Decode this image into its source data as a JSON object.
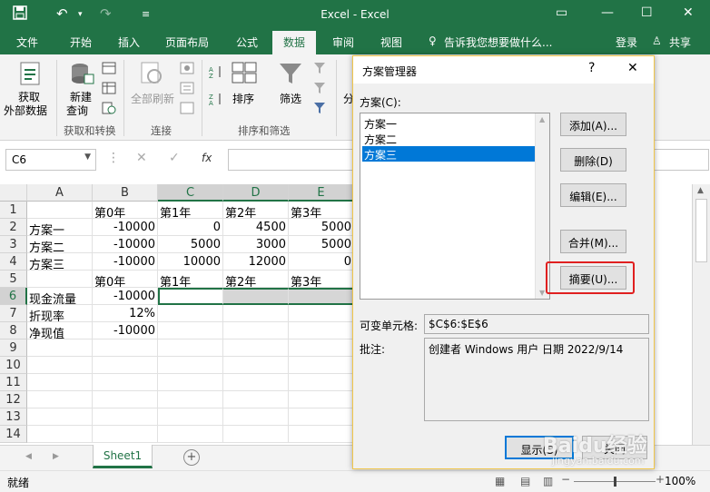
{
  "titlebar": {
    "title": "Excel - Excel",
    "save_icon": "save-icon",
    "undo_icon": "undo-icon",
    "redo_icon": "redo-icon",
    "customize_icon": "customize-icon"
  },
  "tabs": [
    {
      "label": "文件"
    },
    {
      "label": "开始"
    },
    {
      "label": "插入"
    },
    {
      "label": "页面布局"
    },
    {
      "label": "公式"
    },
    {
      "label": "数据"
    },
    {
      "label": "审阅"
    },
    {
      "label": "视图"
    }
  ],
  "tellme": "告诉我您想要做什么...",
  "login": "登录",
  "share": "共享",
  "ribbon": {
    "get_data_1": "获取",
    "get_data_2": "外部数据",
    "new_query_1": "新建",
    "new_query_2": "查询",
    "group_get_transform": "获取和转换",
    "refresh_all": "全部刷新",
    "group_connections": "连接",
    "sort": "排序",
    "filter": "筛选",
    "group_sort_filter": "排序和筛选",
    "split": "分"
  },
  "formula": {
    "namebox": "C6",
    "fx": "fx"
  },
  "columns": [
    "A",
    "B",
    "C",
    "D",
    "E"
  ],
  "rows": [
    {
      "num": "1",
      "cells": [
        "",
        "第0年",
        "第1年",
        "第2年",
        "第3年"
      ]
    },
    {
      "num": "2",
      "cells": [
        "方案一",
        "-10000",
        "0",
        "4500",
        "5000"
      ]
    },
    {
      "num": "3",
      "cells": [
        "方案二",
        "-10000",
        "5000",
        "3000",
        "5000"
      ]
    },
    {
      "num": "4",
      "cells": [
        "方案三",
        "-10000",
        "10000",
        "12000",
        "0"
      ]
    },
    {
      "num": "5",
      "cells": [
        "",
        "第0年",
        "第1年",
        "第2年",
        "第3年"
      ]
    },
    {
      "num": "6",
      "cells": [
        "现金流量",
        "-10000",
        "",
        "",
        ""
      ]
    },
    {
      "num": "7",
      "cells": [
        "折现率",
        "12%",
        "",
        "",
        ""
      ]
    },
    {
      "num": "8",
      "cells": [
        "净现值",
        "-10000",
        "",
        "",
        ""
      ]
    },
    {
      "num": "9",
      "cells": [
        "",
        "",
        "",
        "",
        ""
      ]
    },
    {
      "num": "10",
      "cells": [
        "",
        "",
        "",
        "",
        ""
      ]
    },
    {
      "num": "11",
      "cells": [
        "",
        "",
        "",
        "",
        ""
      ]
    },
    {
      "num": "12",
      "cells": [
        "",
        "",
        "",
        "",
        ""
      ]
    },
    {
      "num": "13",
      "cells": [
        "",
        "",
        "",
        "",
        ""
      ]
    },
    {
      "num": "14",
      "cells": [
        "",
        "",
        "",
        "",
        ""
      ]
    }
  ],
  "sheet": {
    "tab": "Sheet1",
    "add": "+"
  },
  "status": {
    "ready": "就绪",
    "zoom": "100%"
  },
  "dialog": {
    "title": "方案管理器",
    "help": "?",
    "close": "✕",
    "scenarios_label": "方案(C):",
    "scenarios": [
      {
        "name": "方案一"
      },
      {
        "name": "方案二"
      },
      {
        "name": "方案三"
      }
    ],
    "buttons": {
      "add": "添加(A)...",
      "delete": "删除(D)",
      "edit": "编辑(E)...",
      "merge": "合并(M)...",
      "summary": "摘要(U)...",
      "show": "显示(S)",
      "close": "关闭"
    },
    "changing_cells_label": "可变单元格:",
    "changing_cells": "$C$6:$E$6",
    "comment_label": "批注:",
    "comment": "创建者 Windows 用户 日期 2022/9/14"
  },
  "watermark": {
    "logo": "Baidu经验",
    "url": "jingyan.baidu.com"
  }
}
